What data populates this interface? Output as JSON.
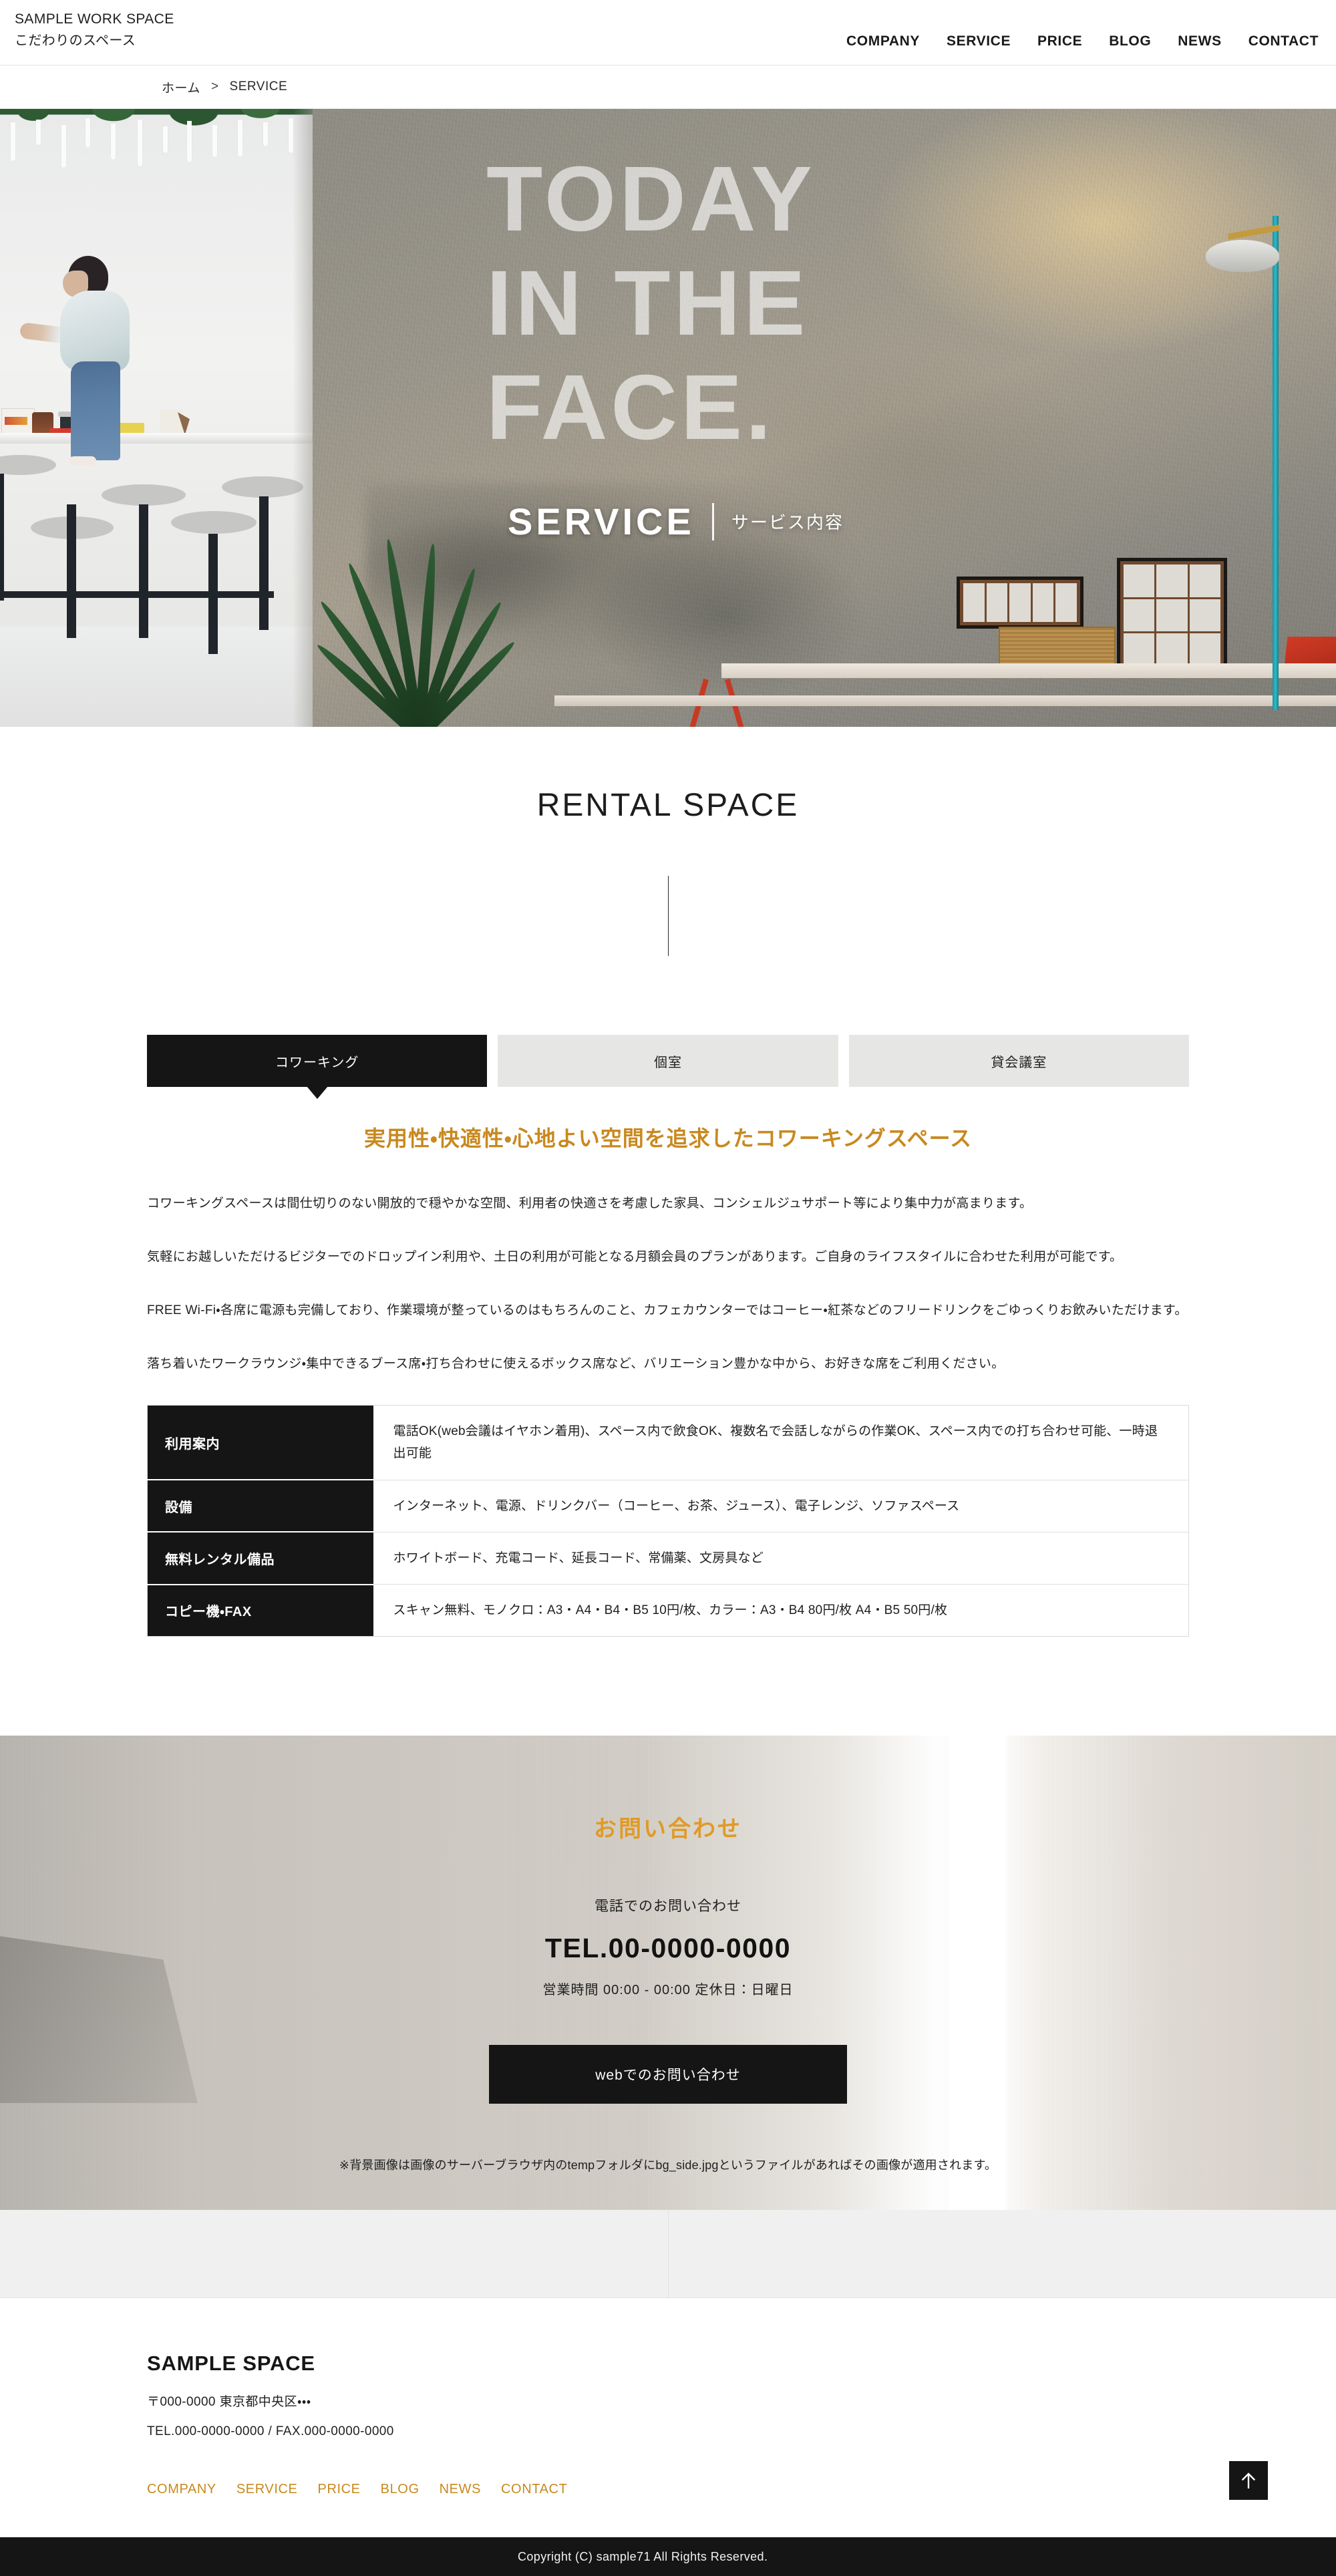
{
  "header": {
    "brand_name": "SAMPLE WORK SPACE",
    "brand_sub": "こだわりのスペース",
    "nav": [
      {
        "label": "COMPANY"
      },
      {
        "label": "SERVICE"
      },
      {
        "label": "PRICE"
      },
      {
        "label": "BLOG"
      },
      {
        "label": "NEWS"
      },
      {
        "label": "CONTACT"
      }
    ]
  },
  "breadcrumb": {
    "home": "ホーム",
    "separator": ">",
    "current": "SERVICE"
  },
  "hero": {
    "painted_line1": "TODAY",
    "painted_line2": "IN THE",
    "painted_line3": "FACE.",
    "title": "SERVICE",
    "subtitle": "サービス内容"
  },
  "section": {
    "title": "RENTAL SPACE"
  },
  "tabs": [
    {
      "label": "コワーキング",
      "active": true
    },
    {
      "label": "個室",
      "active": false
    },
    {
      "label": "貸会議室",
      "active": false
    }
  ],
  "lead_heading": "実用性・快適性・心地よい空間を追求したコワーキングスペース",
  "paragraphs": [
    "コワーキングスペースは間仕切りのない開放的で穏やかな空間、利用者の快適さを考慮した家具、コンシェルジュサポート等により集中力が高まります。",
    "気軽にお越しいただけるビジターでのドロップイン利用や、土日の利用が可能となる月額会員のプランがあります。ご自身のライフスタイルに合わせた利用が可能です。",
    "FREE Wi-Fi・各席に電源も完備しており、作業環境が整っているのはもちろんのこと、カフェカウンターではコーヒー・紅茶などのフリードリンクをごゆっくりお飲みいただけます。",
    "落ち着いたワークラウンジ・集中できるブース席・打ち合わせに使えるボックス席など、バリエーション豊かな中から、お好きな席をご利用ください。"
  ],
  "spec_table": {
    "rows": [
      {
        "label": "利用案内",
        "value": "電話OK(web会議はイヤホン着用)、スペース内で飲食OK、複数名で会話しながらの作業OK、スペース内での打ち合わせ可能、一時退出可能"
      },
      {
        "label": "設備",
        "value": "インターネット、電源、ドリンクバー（コーヒー、お茶、ジュース）、電子レンジ、ソファスペース"
      },
      {
        "label": "無料レンタル備品",
        "value": "ホワイトボード、充電コード、延長コード、常備薬、文房具など"
      },
      {
        "label": "コピー機・FAX",
        "value": "スキャン無料、モノクロ：A3・A4・B4・B5 10円/枚、カラー：A3・B4 80円/枚 A4・B5 50円/枚"
      }
    ]
  },
  "contact": {
    "title": "お問い合わせ",
    "lead": "電話でのお問い合わせ",
    "tel": "TEL.00-0000-0000",
    "hours": "営業時間 00:00 - 00:00 定休日：日曜日",
    "button_label": "webでのお問い合わせ",
    "note": "※背景画像は画像のサーバーブラウザ内のtempフォルダにbg_side.jpgというファイルがあればその画像が適用されます。"
  },
  "footer": {
    "brand": "SAMPLE SPACE",
    "address": "〒000-0000 東京都中央区・・・",
    "contact": "TEL.000-0000-0000 / FAX.000-0000-0000",
    "nav": [
      {
        "label": "COMPANY"
      },
      {
        "label": "SERVICE"
      },
      {
        "label": "PRICE"
      },
      {
        "label": "BLOG"
      },
      {
        "label": "NEWS"
      },
      {
        "label": "CONTACT"
      }
    ],
    "to_top_icon": "arrow-up-icon",
    "copyright": "Copyright (C) sample71 All Rights Reserved."
  },
  "colors": {
    "accent_orange": "#c8891f",
    "contact_orange": "#e09a26",
    "dark": "#151515",
    "tab_inactive": "#e6e6e4"
  }
}
